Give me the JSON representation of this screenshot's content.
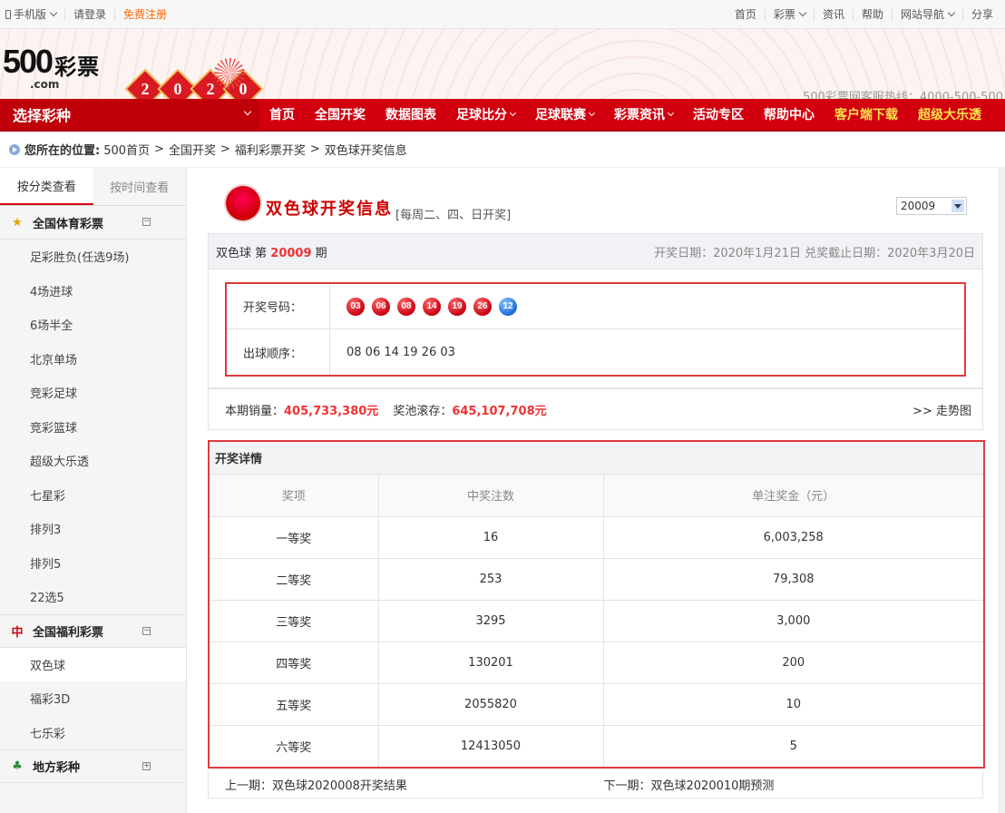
{
  "topbar": {
    "mobile": "手机版",
    "login": "请登录",
    "register": "免费注册",
    "right": [
      "首页",
      "彩票",
      "资讯",
      "帮助",
      "网站导航",
      "分享"
    ]
  },
  "header": {
    "logo_main": "500",
    "logo_cp": "彩票",
    "logo_com": ".com",
    "year_digits": [
      "2",
      "0",
      "2",
      "0"
    ],
    "hotline": "500彩票网客服热线：4000-500-500"
  },
  "nav": {
    "select_label": "选择彩种",
    "items": [
      "首页",
      "全国开奖",
      "数据图表",
      "足球比分",
      "足球联赛",
      "彩票资讯",
      "活动专区",
      "帮助中心",
      "客户端下载",
      "超级大乐透"
    ]
  },
  "breadcrumb": {
    "prefix": "您所在的位置:",
    "parts": [
      "500首页",
      "全国开奖",
      "福利彩票开奖",
      "双色球开奖信息"
    ]
  },
  "sidebar": {
    "tabs": [
      "按分类查看",
      "按时间查看"
    ],
    "group1": "全国体育彩票",
    "group1_items": [
      "足彩胜负(任选9场)",
      "4场进球",
      "6场半全",
      "北京单场",
      "竞彩足球",
      "竞彩篮球",
      "超级大乐透",
      "七星彩",
      "排列3",
      "排列5",
      "22选5"
    ],
    "group2": "全国福利彩票",
    "group2_items": [
      "双色球",
      "福彩3D",
      "七乐彩"
    ],
    "group3": "地方彩种",
    "toggle_minus": "−",
    "toggle_plus": "+"
  },
  "lottery": {
    "title": "双色球开奖信息",
    "schedule": "[每周二、四、日开奖]",
    "issue_selected": "20009",
    "period_prefix": "双色球 第",
    "period_num": "20009",
    "period_suffix": "期",
    "dates": "开奖日期：2020年1月21日 兑奖截止日期：2020年3月20日",
    "draw_label": "开奖号码：",
    "red_balls": [
      "03",
      "06",
      "08",
      "14",
      "19",
      "26"
    ],
    "blue_ball": "12",
    "order_label": "出球顺序：",
    "order_value": "08 06 14 19 26 03",
    "sales_label": "本期销量：",
    "sales_value": "405,733,380元",
    "pool_label": "奖池滚存：",
    "pool_value": "645,107,708元",
    "trend": ">> 走势图"
  },
  "detail": {
    "title": "开奖详情",
    "headers": [
      "奖项",
      "中奖注数",
      "单注奖金（元）"
    ],
    "rows": [
      [
        "一等奖",
        "16",
        "6,003,258"
      ],
      [
        "二等奖",
        "253",
        "79,308"
      ],
      [
        "三等奖",
        "3295",
        "3,000"
      ],
      [
        "四等奖",
        "130201",
        "200"
      ],
      [
        "五等奖",
        "2055820",
        "10"
      ],
      [
        "六等奖",
        "12413050",
        "5"
      ]
    ]
  },
  "pager": {
    "prev": "上一期：双色球2020008开奖结果",
    "next": "下一期：双色球2020010期预测"
  }
}
